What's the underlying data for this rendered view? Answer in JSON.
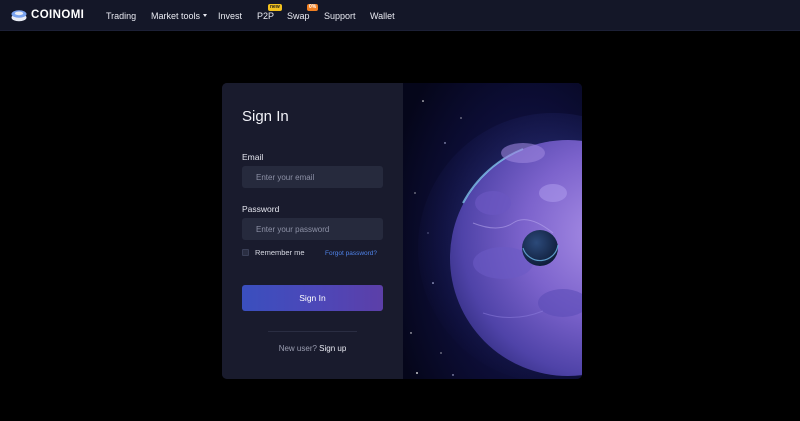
{
  "brand": {
    "name": "COINOMI"
  },
  "nav": {
    "items": [
      {
        "label": "Trading"
      },
      {
        "label": "Market tools"
      },
      {
        "label": "Invest"
      },
      {
        "label": "P2P",
        "badge": "new"
      },
      {
        "label": "Swap",
        "badge": "0%"
      },
      {
        "label": "Support"
      },
      {
        "label": "Wallet"
      }
    ]
  },
  "signin": {
    "title": "Sign In",
    "email_label": "Email",
    "email_placeholder": "Enter your email",
    "password_label": "Password",
    "password_placeholder": "Enter your password",
    "remember_label": "Remember me",
    "forgot_label": "Forgot password?",
    "button_label": "Sign In",
    "new_user_text": "New user?",
    "signup_label": "Sign up"
  },
  "colors": {
    "accent": "#4f83e8",
    "button_start": "#3a4fbe",
    "button_end": "#5c3fa8",
    "badge_new": "#f3c21f",
    "badge_swap": "#f07f22"
  }
}
